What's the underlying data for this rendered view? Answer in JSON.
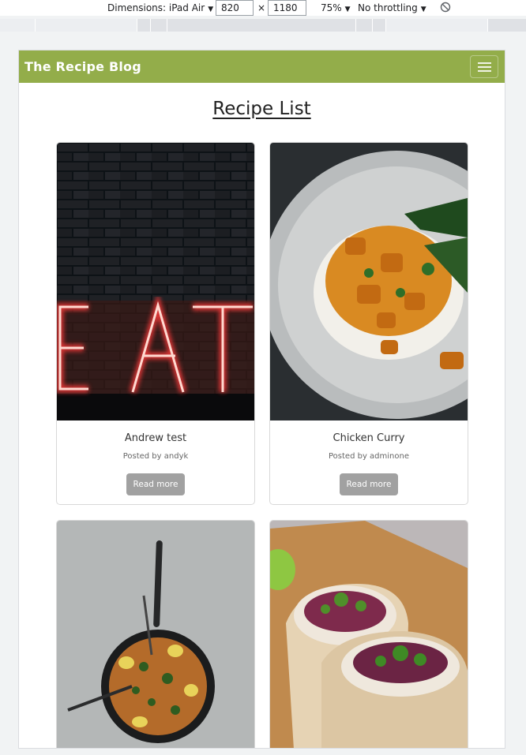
{
  "devtools": {
    "dimensions_label": "Dimensions: iPad Air",
    "width": "820",
    "times": "×",
    "height": "1180",
    "zoom": "75%",
    "throttling": "No throttling"
  },
  "site": {
    "brand": "The Recipe Blog",
    "page_title": "Recipe List",
    "colors": {
      "navbar": "#93ad4a",
      "button": "#a1a1a1"
    }
  },
  "cards": [
    {
      "title": "Andrew test",
      "meta": "Posted by andyk",
      "button": "Read more",
      "image": "neon-eat-sign"
    },
    {
      "title": "Chicken Curry",
      "meta": "Posted by adminone",
      "button": "Read more",
      "image": "curry-plate"
    },
    {
      "title": "",
      "meta": "",
      "button": "",
      "image": "paella-pan"
    },
    {
      "title": "",
      "meta": "",
      "button": "",
      "image": "wrap-rolls"
    }
  ]
}
